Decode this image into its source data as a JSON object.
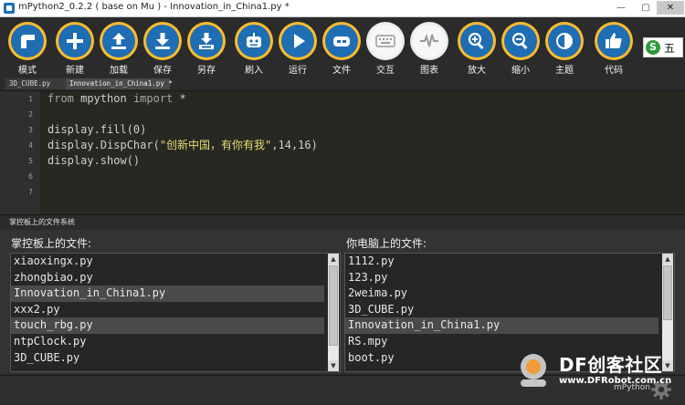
{
  "window": {
    "title": "mPython2_0.2.2 ( base on Mu ) - Innovation_in_China1.py *",
    "controls": {
      "minimize": "—",
      "maximize": "▢",
      "close": "✕"
    }
  },
  "toolbar": {
    "buttons": [
      {
        "id": "mode",
        "label": "模式",
        "icon": "mode-icon"
      },
      {
        "id": "new",
        "label": "新建",
        "icon": "plus-icon"
      },
      {
        "id": "load",
        "label": "加载",
        "icon": "upload-icon"
      },
      {
        "id": "save",
        "label": "保存",
        "icon": "download-icon"
      },
      {
        "id": "saveas",
        "label": "另存",
        "icon": "save-as-icon"
      },
      {
        "id": "flash",
        "label": "刷入",
        "icon": "robot-icon"
      },
      {
        "id": "run",
        "label": "运行",
        "icon": "play-icon"
      },
      {
        "id": "files",
        "label": "文件",
        "icon": "gamepad-icon"
      },
      {
        "id": "repl",
        "label": "交互",
        "icon": "keyboard-icon"
      },
      {
        "id": "plotter",
        "label": "图表",
        "icon": "pulse-icon"
      },
      {
        "id": "zoomin",
        "label": "放大",
        "icon": "zoom-in-icon"
      },
      {
        "id": "zoomout",
        "label": "缩小",
        "icon": "zoom-out-icon"
      },
      {
        "id": "theme",
        "label": "主题",
        "icon": "contrast-icon"
      },
      {
        "id": "check",
        "label": "代码",
        "icon": "thumbs-up-icon"
      }
    ],
    "ime": {
      "logo": "S",
      "text": "五"
    }
  },
  "tabs": [
    {
      "label": "3D_CUBE.py",
      "active": false
    },
    {
      "label": "Innovation_in_China1.py *",
      "active": true
    }
  ],
  "editor": {
    "line_numbers": [
      "1",
      "2",
      "3",
      "4",
      "5",
      "6",
      "7"
    ],
    "lines": [
      {
        "pre": "",
        "kw1": "from",
        "mid": " mpython ",
        "kw2": "import",
        "post": " *"
      },
      {
        "text": ""
      },
      {
        "text": "display.fill(0)"
      },
      {
        "pre": "display.DispChar(",
        "str": "\"创新中国，有你有我\"",
        "post": ",14,16)"
      },
      {
        "text": "display.show()"
      },
      {
        "text": ""
      },
      {
        "text": ""
      }
    ]
  },
  "filepane": {
    "title": "掌控板上的文件系统",
    "device": {
      "label": "掌控板上的文件:",
      "files": [
        "xiaoxingx.py",
        "zhongbiao.py",
        "Innovation_in_China1.py",
        "xxx2.py",
        "touch_rbg.py",
        "ntpClock.py",
        "3D_CUBE.py"
      ],
      "selected": [
        2,
        4
      ]
    },
    "local": {
      "label": "你电脑上的文件:",
      "files": [
        "1112.py",
        "123.py",
        "2weima.py",
        "3D_CUBE.py",
        "Innovation_in_China1.py",
        "RS.mpy",
        "boot.py"
      ],
      "selected": [
        4
      ]
    },
    "scroll_up": "▲",
    "scroll_down": "▼"
  },
  "statusbar": {
    "mode": "mPython"
  },
  "watermark": {
    "text": "DF创客社区",
    "url": "www.DFRobot.com.cn"
  },
  "colors": {
    "accent": "#fdbc2d",
    "button_blue": "#1f6db3",
    "background": "#2b2b2b"
  }
}
